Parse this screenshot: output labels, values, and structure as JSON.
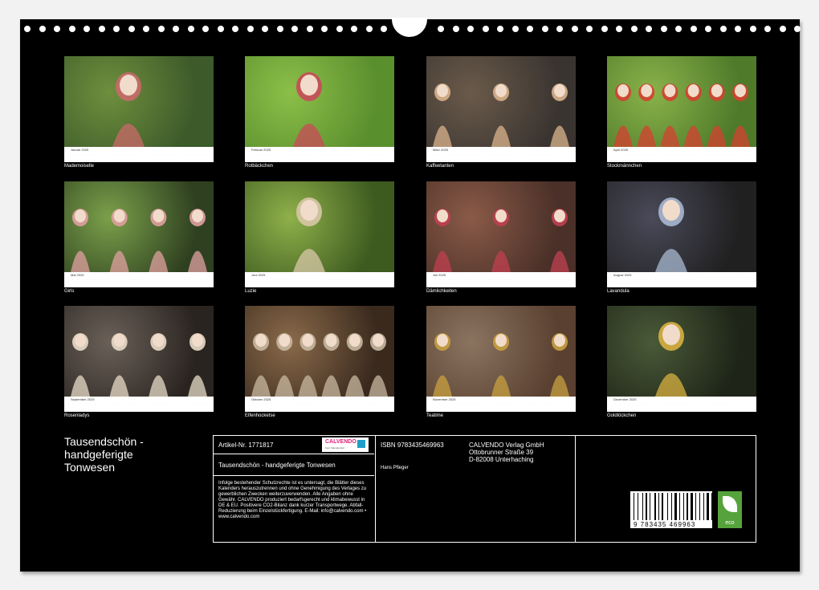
{
  "calendar": {
    "months": [
      {
        "name": "Januar 2025",
        "caption": "Mademoiselle"
      },
      {
        "name": "Februar 2025",
        "caption": "Rotbäckchen"
      },
      {
        "name": "März 2025",
        "caption": "Kaffeetanten"
      },
      {
        "name": "April 2025",
        "caption": "Stockmännchen"
      },
      {
        "name": "Mai 2025",
        "caption": "Girls"
      },
      {
        "name": "Juni 2025",
        "caption": "Luzie"
      },
      {
        "name": "Juli 2025",
        "caption": "Dämlichkeiten"
      },
      {
        "name": "August 2025",
        "caption": "Lavandula"
      },
      {
        "name": "September 2025",
        "caption": "Rosenladys"
      },
      {
        "name": "Oktober 2025",
        "caption": "Elfenhocketse"
      },
      {
        "name": "November 2025",
        "caption": "Teatime"
      },
      {
        "name": "Dezember 2025",
        "caption": "Goldlöckchen"
      }
    ],
    "colors": {
      "background": "#000000",
      "strip": "#ffffff",
      "accent": "#e0217a"
    }
  },
  "back": {
    "title_line1": "Tausendschön -",
    "title_line2": "handgeferigte",
    "title_line3": "Tonwesen",
    "article": "Artikel-Nr. 1771817",
    "calvendo_logo": "CALVENDO",
    "calvendo_sub": "Kein Kalenderwitz",
    "product_title": "Tausendschön - handgeferigte Tonwesen",
    "isbn": "ISBN 9783435469963",
    "author": "Hans Pfleger",
    "publisher_name": "CALVENDO Verlag GmbH",
    "publisher_street": "Ottobrunner Straße 39",
    "publisher_city": "D-82008 Unterhaching",
    "legal": "Infolge bestehender Schutzrechte ist es untersagt, die Blätter dieses Kalenders herauszutrennen und ohne Genehmigung des Verlages zu gewerblichen Zwecken weiterzuverwenden. Alle Angaben ohne Gewähr. CALVENDO produziert bedarfsgerecht und klimabewusst in DE & EU. Positivere CO2-Bilanz dank kurzer Transportwege. Abfall-Reduzierung beim Einzelstückfertigung. E-Mail: info@calvendo.com • www.calvendo.com",
    "barcode_number": "9 783435 469963",
    "eco_label": "eco"
  }
}
